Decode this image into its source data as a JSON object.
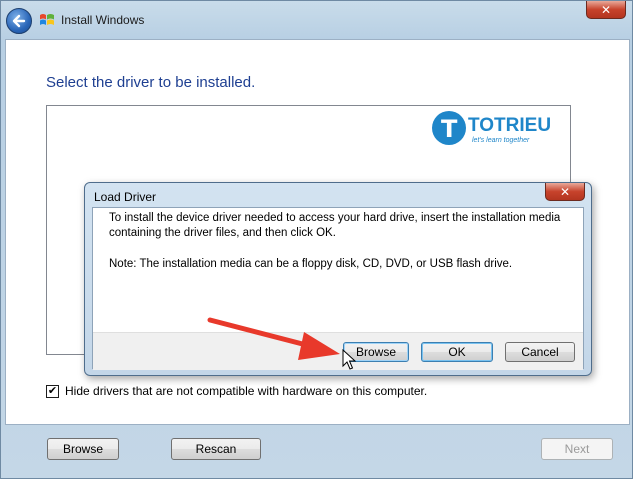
{
  "window": {
    "title": "Install Windows",
    "close_label": "✕"
  },
  "page": {
    "heading": "Select the driver to be installed.",
    "hide_drivers_label": "Hide drivers that are not compatible with hardware on this computer.",
    "hide_drivers_checked": true,
    "checkbox_mark": "✔"
  },
  "watermark": {
    "logo_letter": "T",
    "brand": "TOTRIEU",
    "slogan": "let's learn together"
  },
  "footer": {
    "browse_label": "Browse",
    "rescan_label": "Rescan",
    "next_label": "Next"
  },
  "dialog": {
    "title": "Load Driver",
    "close_label": "✕",
    "message": "To install the device driver needed to access your hard drive, insert the installation media containing the driver files, and then click OK.",
    "note": "Note: The installation media can be a floppy disk, CD, DVD, or USB flash drive.",
    "browse_label": "Browse",
    "ok_label": "OK",
    "cancel_label": "Cancel"
  },
  "colors": {
    "heading": "#1e3f91",
    "arrow": "#e8392b",
    "brand": "#1f86c9"
  },
  "icons": {
    "back": "back-arrow-icon",
    "windows_logo": "windows-logo-icon",
    "close": "close-icon",
    "cursor": "mouse-cursor-icon"
  }
}
